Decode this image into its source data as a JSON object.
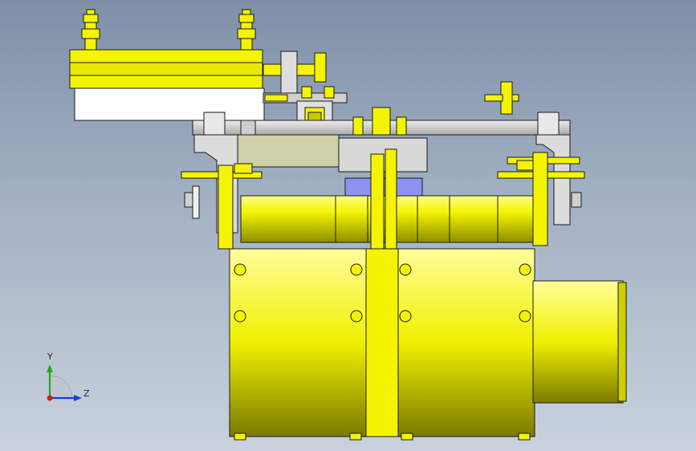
{
  "viewport": {
    "background_top": "#7e90a8",
    "background_bottom": "#c9d2dc"
  },
  "model": {
    "part_color": "#f4f400",
    "part_shadow": "#a0a000",
    "plate_color": "#c8c8c8",
    "plate_light": "#ffffff",
    "accent_blue": "#8e92f0",
    "edge_color": "#1a1a1a"
  },
  "triad": {
    "y_axis_label": "Y",
    "z_axis_label": "Z",
    "y_axis_color": "#1ab01a",
    "z_axis_color": "#1a3ce0",
    "x_axis_color": "#e01a1a"
  }
}
